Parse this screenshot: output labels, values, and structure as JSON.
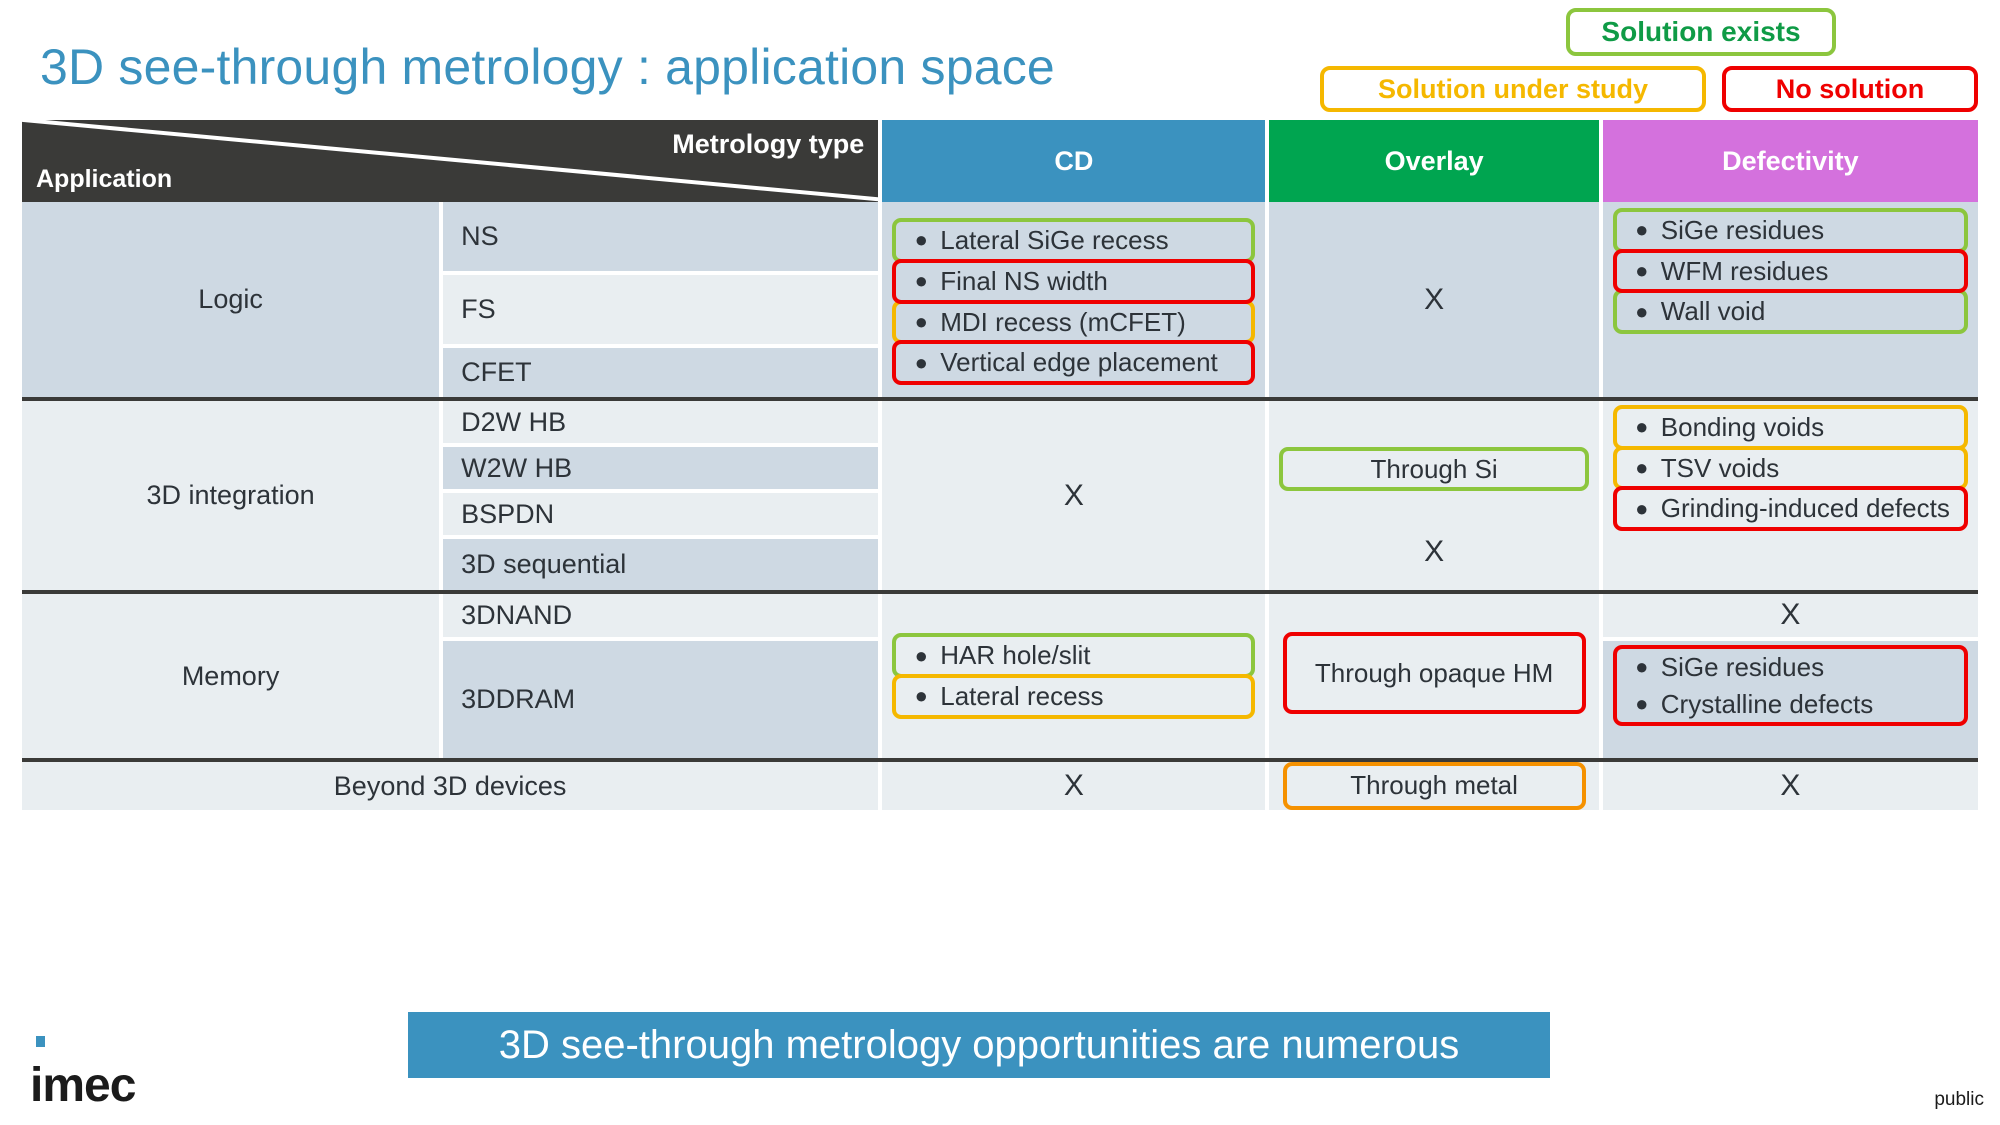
{
  "title": "3D see-through metrology : application space",
  "colors": {
    "title": "#3b92bf",
    "green": "#8cc63e",
    "yellow": "#f5b800",
    "orange": "#f59100",
    "red": "#ef0000",
    "header_cd": "#3b92bf",
    "header_overlay": "#00a550",
    "header_defectivity": "#d471dd",
    "header_corner": "#3a3a38",
    "row_tint_a": "#ced9e3",
    "row_tint_b": "#e9eef1"
  },
  "legend": [
    {
      "label": "Solution exists",
      "color": "#8cc63e"
    },
    {
      "label": "Solution under study",
      "color": "#f5b800"
    },
    {
      "label": "No solution",
      "color": "#ef0000"
    }
  ],
  "header": {
    "metrology_type": "Metrology type",
    "application": "Application",
    "cd": "CD",
    "overlay": "Overlay",
    "defectivity": "Defectivity"
  },
  "bands": [
    {
      "application": "Logic",
      "types": [
        "NS",
        "FS",
        "CFET"
      ],
      "cd": [
        {
          "text": "Lateral SiGe recess",
          "status": "green",
          "bullet": true
        },
        {
          "text": "Final NS width",
          "status": "red",
          "bullet": true
        },
        {
          "text": "MDI recess (mCFET)",
          "status": "yellow",
          "bullet": true
        },
        {
          "text": "Vertical edge placement",
          "status": "red",
          "bullet": true
        }
      ],
      "overlay": "X",
      "defectivity": [
        {
          "text": "SiGe residues",
          "status": "green",
          "bullet": true
        },
        {
          "text": "WFM residues",
          "status": "red",
          "bullet": true
        },
        {
          "text": "Wall void",
          "status": "green",
          "bullet": true
        }
      ]
    },
    {
      "application": "3D integration",
      "types": [
        "D2W HB",
        "W2W HB",
        "BSPDN",
        "3D sequential"
      ],
      "cd": "X",
      "overlay_chip": {
        "text": "Through Si",
        "status": "green"
      },
      "overlay_x": "X",
      "defectivity": [
        {
          "text": "Bonding voids",
          "status": "yellow",
          "bullet": true
        },
        {
          "text": "TSV voids",
          "status": "yellow",
          "bullet": true
        },
        {
          "text": "Grinding-induced defects",
          "status": "red",
          "bullet": true
        }
      ]
    },
    {
      "application": "Memory",
      "types": [
        "3DNAND",
        "3DDRAM"
      ],
      "cd": [
        {
          "text": "HAR hole/slit",
          "status": "green",
          "bullet": true
        },
        {
          "text": "Lateral recess",
          "status": "yellow",
          "bullet": true
        }
      ],
      "overlay_chip": {
        "text": "Through opaque HM",
        "status": "red"
      },
      "defectivity_x": "X",
      "defectivity": [
        {
          "text": "SiGe residues",
          "status": "red",
          "bullet": true
        },
        {
          "text": "Crystalline defects",
          "status": "red",
          "bullet": true
        }
      ]
    },
    {
      "application": "Beyond 3D devices",
      "cd": "X",
      "overlay_chip": {
        "text": "Through metal",
        "status": "orange"
      },
      "defectivity_x": "X"
    }
  ],
  "footer": {
    "banner": "3D see-through metrology opportunities are numerous",
    "logo": "imec",
    "classification": "public"
  }
}
